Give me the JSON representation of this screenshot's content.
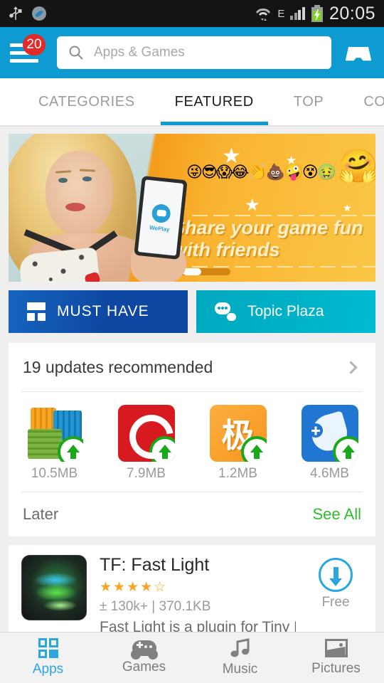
{
  "status_bar": {
    "icons": [
      "usb-icon",
      "dolphin-app-icon"
    ],
    "wifi": "wifi-icon",
    "network_type": "E",
    "signal": "signal-bars-icon",
    "battery": "battery-charging-icon",
    "clock": "20:05"
  },
  "header": {
    "menu_badge": "20",
    "search_placeholder": "Apps & Games",
    "search_value": "",
    "inbox_icon": "inbox-icon",
    "bg_color": "#0e9bd1"
  },
  "tabs": [
    {
      "label": "CATEGORIES",
      "active": false
    },
    {
      "label": "FEATURED",
      "active": true
    },
    {
      "label": "TOP",
      "active": false
    },
    {
      "label": "COLLECT",
      "active": false
    }
  ],
  "banner": {
    "headline_line1": "Share your game fun",
    "headline_line2": "with friends",
    "app_logo_text": "WePlay",
    "emoji_strip": "😜😎😱😂👏💩🤪😵🤢",
    "emoji_big": "🤗",
    "pager_total": 3,
    "pager_active": 2
  },
  "quick_buttons": [
    {
      "label": "MUST HAVE",
      "icon": "grid-icon",
      "color": "#0d47a1"
    },
    {
      "label": "Topic Plaza",
      "icon": "chat-bubble-icon",
      "color": "#00b2c6"
    }
  ],
  "updates_card": {
    "title": "19 updates recommended",
    "chevron": "chevron-right-icon",
    "apps": [
      {
        "name": "rar-app-icon",
        "size": "10.5MB"
      },
      {
        "name": "red-app-icon",
        "size": "7.9MB"
      },
      {
        "name": "orange-app-icon",
        "glyph": "极",
        "size": "1.2MB"
      },
      {
        "name": "blue-dolphin-app-icon",
        "size": "4.6MB"
      }
    ],
    "later_label": "Later",
    "see_all_label": "See All",
    "see_all_color": "#2fbd2f"
  },
  "app_list": [
    {
      "title": "TF: Fast Light",
      "rating": 4,
      "rating_max": 5,
      "stars_text": "★★★★☆",
      "downloads": "130k+",
      "size": "370.1KB",
      "meta": "± 130k+  |  370.1KB",
      "description": "Fast Light is a plugin for Tiny Flashlight and",
      "action_label": "Free",
      "action_icon": "download-circle-icon"
    }
  ],
  "bottom_nav": [
    {
      "label": "Apps",
      "icon": "apps-grid-icon",
      "active": true
    },
    {
      "label": "Games",
      "icon": "gamepad-icon",
      "active": false
    },
    {
      "label": "Music",
      "icon": "music-note-icon",
      "active": false
    },
    {
      "label": "Pictures",
      "icon": "picture-icon",
      "active": false
    }
  ],
  "theme": {
    "accent": "#0e9bd1",
    "nav_accent": "#2ca6e0",
    "badge_red": "#e02b28",
    "green": "#2fbd2f",
    "page_bg": "#efefef"
  }
}
